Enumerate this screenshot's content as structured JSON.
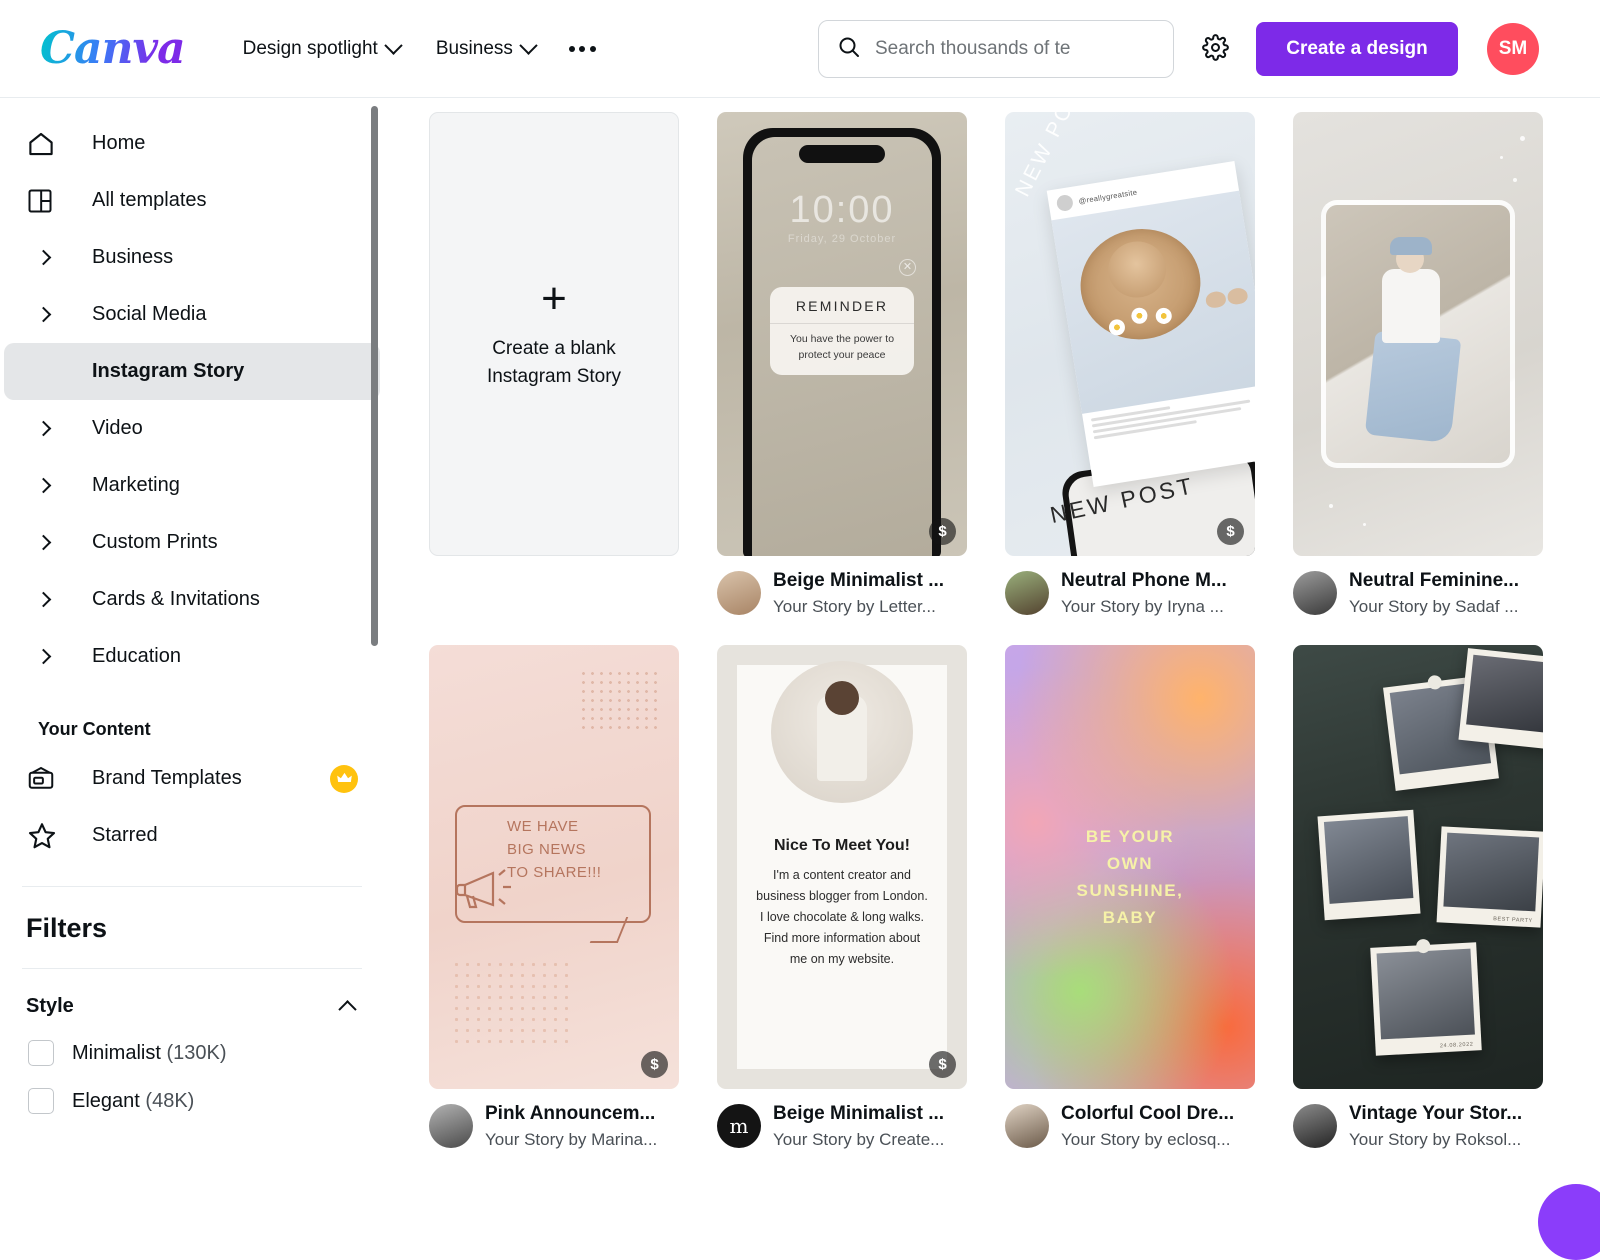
{
  "header": {
    "logo_text": "Canva",
    "nav": [
      {
        "label": "Design spotlight",
        "icon": "chevron-down-icon"
      },
      {
        "label": "Business",
        "icon": "chevron-down-icon"
      }
    ],
    "more_icon": "more-horizontal-icon",
    "search": {
      "placeholder": "Search thousands of te",
      "value": "",
      "icon": "search-icon"
    },
    "settings_icon": "gear-icon",
    "create_button": "Create a design",
    "avatar_initials": "SM",
    "accent_color": "#7d2ae8",
    "avatar_color": "#ff4d5e"
  },
  "sidebar": {
    "items": [
      {
        "label": "Home",
        "icon": "home-icon",
        "type": "icon",
        "active": false
      },
      {
        "label": "All templates",
        "icon": "templates-icon",
        "type": "icon",
        "active": false
      },
      {
        "label": "Business",
        "icon": "chevron-right-icon",
        "type": "expand",
        "active": false
      },
      {
        "label": "Social Media",
        "icon": "chevron-right-icon",
        "type": "expand",
        "active": false
      },
      {
        "label": "Instagram Story",
        "icon": "",
        "type": "child",
        "active": true
      },
      {
        "label": "Video",
        "icon": "chevron-right-icon",
        "type": "expand",
        "active": false
      },
      {
        "label": "Marketing",
        "icon": "chevron-right-icon",
        "type": "expand",
        "active": false
      },
      {
        "label": "Custom Prints",
        "icon": "chevron-right-icon",
        "type": "expand",
        "active": false
      },
      {
        "label": "Cards & Invitations",
        "icon": "chevron-right-icon",
        "type": "expand",
        "active": false
      },
      {
        "label": "Education",
        "icon": "chevron-right-icon",
        "type": "expand",
        "active": false
      }
    ],
    "your_content_heading": "Your Content",
    "content_items": [
      {
        "label": "Brand Templates",
        "icon": "brand-templates-icon",
        "badge": "crown-icon"
      },
      {
        "label": "Starred",
        "icon": "star-icon",
        "badge": ""
      }
    ],
    "filters_heading": "Filters",
    "filter_groups": [
      {
        "name": "Style",
        "collapse_icon": "chevron-up-icon",
        "options": [
          {
            "label": "Minimalist",
            "count": "(130K)",
            "checked": false
          },
          {
            "label": "Elegant",
            "count": "(48K)",
            "checked": false
          }
        ]
      }
    ]
  },
  "main": {
    "blank_card": {
      "plus": "+",
      "line1": "Create a blank",
      "line2": "Instagram Story"
    },
    "premium_badge": "$",
    "fab_icon": "help-button",
    "templates": [
      {
        "title": "Beige Minimalist ...",
        "author": "Your Story by Letter...",
        "premium": "$",
        "art": "phone-reminder",
        "art_text": {
          "clock": "10:00",
          "date": "Friday, 29 October",
          "heading": "REMINDER",
          "body": "You have the power to protect your peace"
        }
      },
      {
        "title": "Neutral Phone M...",
        "author": "Your Story by Iryna ...",
        "premium": "$",
        "art": "new-post-mockup",
        "art_text": {
          "label_left": "NEW POST",
          "label_bottom": "NEW POST",
          "handle": "@reallygreatsite"
        }
      },
      {
        "title": "Neutral Feminine...",
        "author": "Your Story by Sadaf ...",
        "premium": "",
        "art": "feminine-photo-frame",
        "art_text": {}
      },
      {
        "title": "Pink Announcem...",
        "author": "Your Story by Marina...",
        "premium": "$",
        "art": "pink-announcement",
        "art_text": {
          "line1": "WE HAVE",
          "line2": "BIG NEWS",
          "line3": "TO SHARE!!!"
        }
      },
      {
        "title": "Beige Minimalist ...",
        "author": "Your Story by Create...",
        "premium": "$",
        "art": "nice-to-meet-you",
        "art_text": {
          "heading": "Nice To Meet You!",
          "body": "I'm a content creator and business blogger from London. I love chocolate & long walks. Find more information about me on my website."
        }
      },
      {
        "title": "Colorful Cool Dre...",
        "author": "Your Story by eclosq...",
        "premium": "",
        "art": "gradient-sunshine",
        "art_text": {
          "line1": "BE YOUR",
          "line2": "OWN",
          "line3": "SUNSHINE,",
          "line4": "BABY"
        }
      },
      {
        "title": "Vintage Your Stor...",
        "author": "Your Story by Roksol...",
        "premium": "",
        "art": "vintage-polaroids",
        "art_text": {
          "caption1": "BEST PARTY",
          "caption2": "24.08.2022"
        }
      }
    ],
    "avatar_initials": {
      "beige_minimalist_2": "m"
    }
  }
}
